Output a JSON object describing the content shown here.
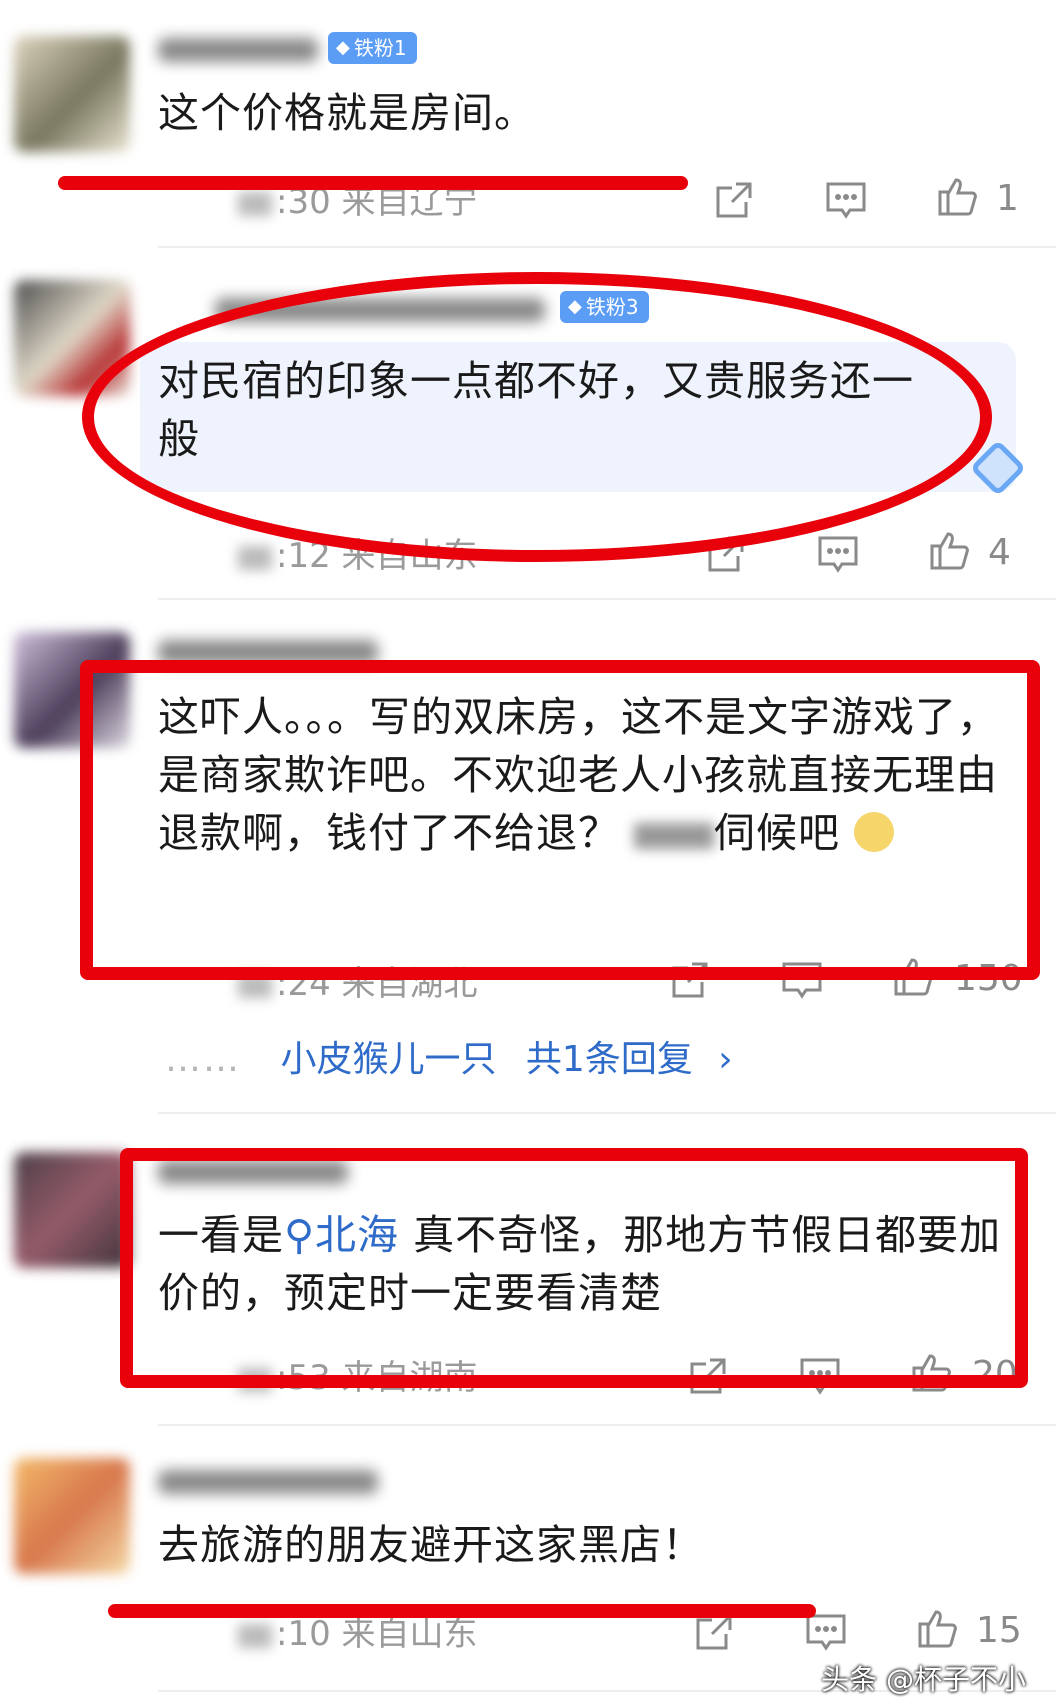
{
  "comments": [
    {
      "badge": "铁粉1",
      "text": "这个价格就是房间。",
      "time": ":30",
      "location": "来自辽宁",
      "likes": "1"
    },
    {
      "badge": "铁粉3",
      "text": "对民宿的印象一点都不好，又贵服务还一般",
      "time": ":12",
      "location": "来自山东",
      "likes": "4"
    },
    {
      "text_parts": [
        "这吓人。。。写的双床房，这不是文字游戏了，是商家欺诈吧。不欢迎老人小孩就直接无理由退款啊，钱付了不给退？ ",
        "伺候吧"
      ],
      "time": ":24",
      "location": "来自湖北",
      "likes": "150",
      "reply_user": "小皮猴儿一只",
      "reply_count": "共1条回复"
    },
    {
      "text_prefix": "一看是",
      "search_term": "北海",
      "text_suffix": "真不奇怪，那地方节假日都要加价的，预定时一定要看清楚",
      "time": ":53",
      "location": "来自湖南",
      "likes": "20"
    },
    {
      "text": "去旅游的朋友避开这家黑店！",
      "time": ":10",
      "location": "来自山东",
      "likes": "15"
    }
  ],
  "reply_dots": "……",
  "reply_arrow": "›",
  "watermark": "头条 @杯子不小",
  "icons": [
    "share-icon",
    "comment-icon",
    "like-icon",
    "diamond-icon",
    "search-icon",
    "dog-emoji"
  ],
  "colors": {
    "annotation_red": "#e8000b",
    "link_blue": "#2f6bc9",
    "badge_blue": "#5b9cf5"
  }
}
